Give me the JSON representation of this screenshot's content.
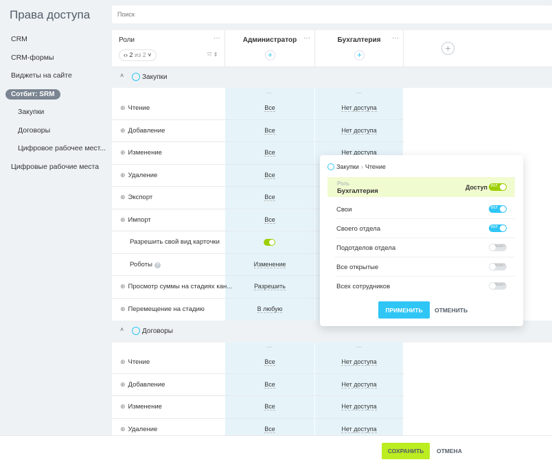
{
  "page_title": "Права доступа",
  "search": {
    "placeholder": "Поиск"
  },
  "sidebar": {
    "items": [
      {
        "label": "CRM"
      },
      {
        "label": "CRM-формы"
      },
      {
        "label": "Виджеты на сайте"
      },
      {
        "label": "Сотбит: SRM"
      },
      {
        "label": "Закупки"
      },
      {
        "label": "Договоры"
      },
      {
        "label": "Цифровое рабочее мест..."
      },
      {
        "label": "Цифровые рабочие места"
      }
    ]
  },
  "header": {
    "roles": "Роли",
    "pager_current": "2",
    "pager_of": "из 2",
    "col_admin": "Администратор",
    "col_buh": "Бухгалтерия",
    "dots": "···",
    "plus": "+"
  },
  "sections": [
    {
      "title": "Закупки",
      "rows": [
        {
          "label": "Чтение",
          "admin": "Все",
          "buh": "Нет доступа"
        },
        {
          "label": "Добавление",
          "admin": "Все",
          "buh": "Нет доступа"
        },
        {
          "label": "Изменение",
          "admin": "Все",
          "buh": "Нет доступа"
        },
        {
          "label": "Удаление",
          "admin": "Все",
          "buh": ""
        },
        {
          "label": "Экспорт",
          "admin": "Все",
          "buh": ""
        },
        {
          "label": "Импорт",
          "admin": "Все",
          "buh": ""
        },
        {
          "label": "Разрешить свой вид карточки",
          "admin": "",
          "buh": ""
        },
        {
          "label": "Роботы",
          "admin": "Изменение",
          "buh": ""
        },
        {
          "label": "Просмотр суммы на стадиях кан...",
          "admin": "Разрешить",
          "buh": ""
        },
        {
          "label": "Перемещение на стадию",
          "admin": "В любую",
          "buh": ""
        }
      ]
    },
    {
      "title": "Договоры",
      "rows": [
        {
          "label": "Чтение",
          "admin": "Все",
          "buh": "Нет доступа"
        },
        {
          "label": "Добавление",
          "admin": "Все",
          "buh": "Нет доступа"
        },
        {
          "label": "Изменение",
          "admin": "Все",
          "buh": "Нет доступа"
        },
        {
          "label": "Удаление",
          "admin": "Все",
          "buh": "Нет доступа"
        }
      ]
    }
  ],
  "popup": {
    "breadcrumb_section": "Закупки",
    "breadcrumb_sep": "›",
    "breadcrumb_perm": "Чтение",
    "role_label": "Роль",
    "role_name": "Бухгалтерия",
    "access_label": "Доступ",
    "options": [
      {
        "label": "Свои",
        "state": "on"
      },
      {
        "label": "Своего отдела",
        "state": "on"
      },
      {
        "label": "Подотделов отдела",
        "state": "off"
      },
      {
        "label": "Все открытые",
        "state": "off"
      },
      {
        "label": "Всех сотрудников",
        "state": "off"
      }
    ],
    "toggle_on_text": "ВКЛ",
    "toggle_off_text": "ВЫКЛ",
    "apply_label": "ПРИМЕНИТЬ",
    "cancel_label": "ОТМЕНИТЬ"
  },
  "footer": {
    "save_label": "СОХРАНИТЬ",
    "cancel_label": "ОТМЕНА"
  },
  "colors": {
    "accent": "#2fc6f6",
    "green": "#9dcf00",
    "save": "#bbed21",
    "cell_bg": "#e6f4fa"
  }
}
